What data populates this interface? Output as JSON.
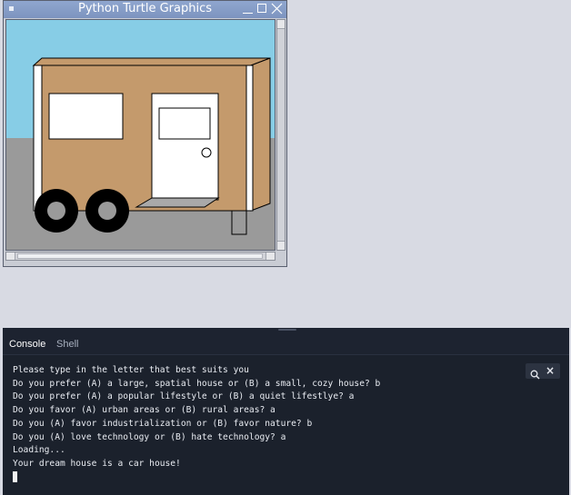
{
  "window": {
    "title": "Python Turtle Graphics",
    "icons": [
      "window-menu-icon",
      "minimize-icon",
      "maximize-icon",
      "close-icon"
    ]
  },
  "scene": {
    "sky_color": "#87cde6",
    "ground_color": "#9a9a9a",
    "house_color": "#c49a6c",
    "door_color": "#ffffff",
    "wheel_color": "#000000"
  },
  "console": {
    "tabs": [
      "Console",
      "Shell"
    ],
    "active_tab": "Console",
    "icons": [
      "search-icon",
      "clear-icon"
    ],
    "lines": [
      "Please type in the letter that best suits you",
      "Do you prefer (A) a large, spatial house or (B) a small, cozy house? b",
      "Do you prefer (A) a popular lifestyle or (B) a quiet lifestlye? a",
      "Do you favor (A) urban areas or (B) rural areas? a",
      "Do you (A) favor industrialization or (B) favor nature? b",
      "Do you (A) love technology or (B) hate technology? a",
      "Loading...",
      "Your dream house is a car house!"
    ]
  }
}
